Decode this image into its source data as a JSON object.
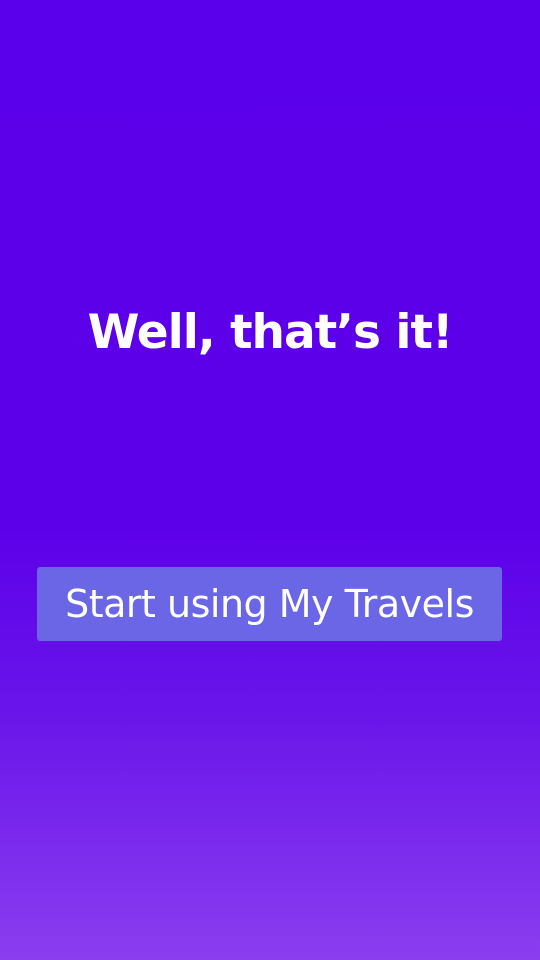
{
  "screen": {
    "headline": "Well, that’s it!",
    "cta_label": "Start using My Travels"
  },
  "colors": {
    "background_top": "#5b00ea",
    "background_bottom": "#8a3eef",
    "button_background": "#6a66e6",
    "text": "#ffffff"
  }
}
